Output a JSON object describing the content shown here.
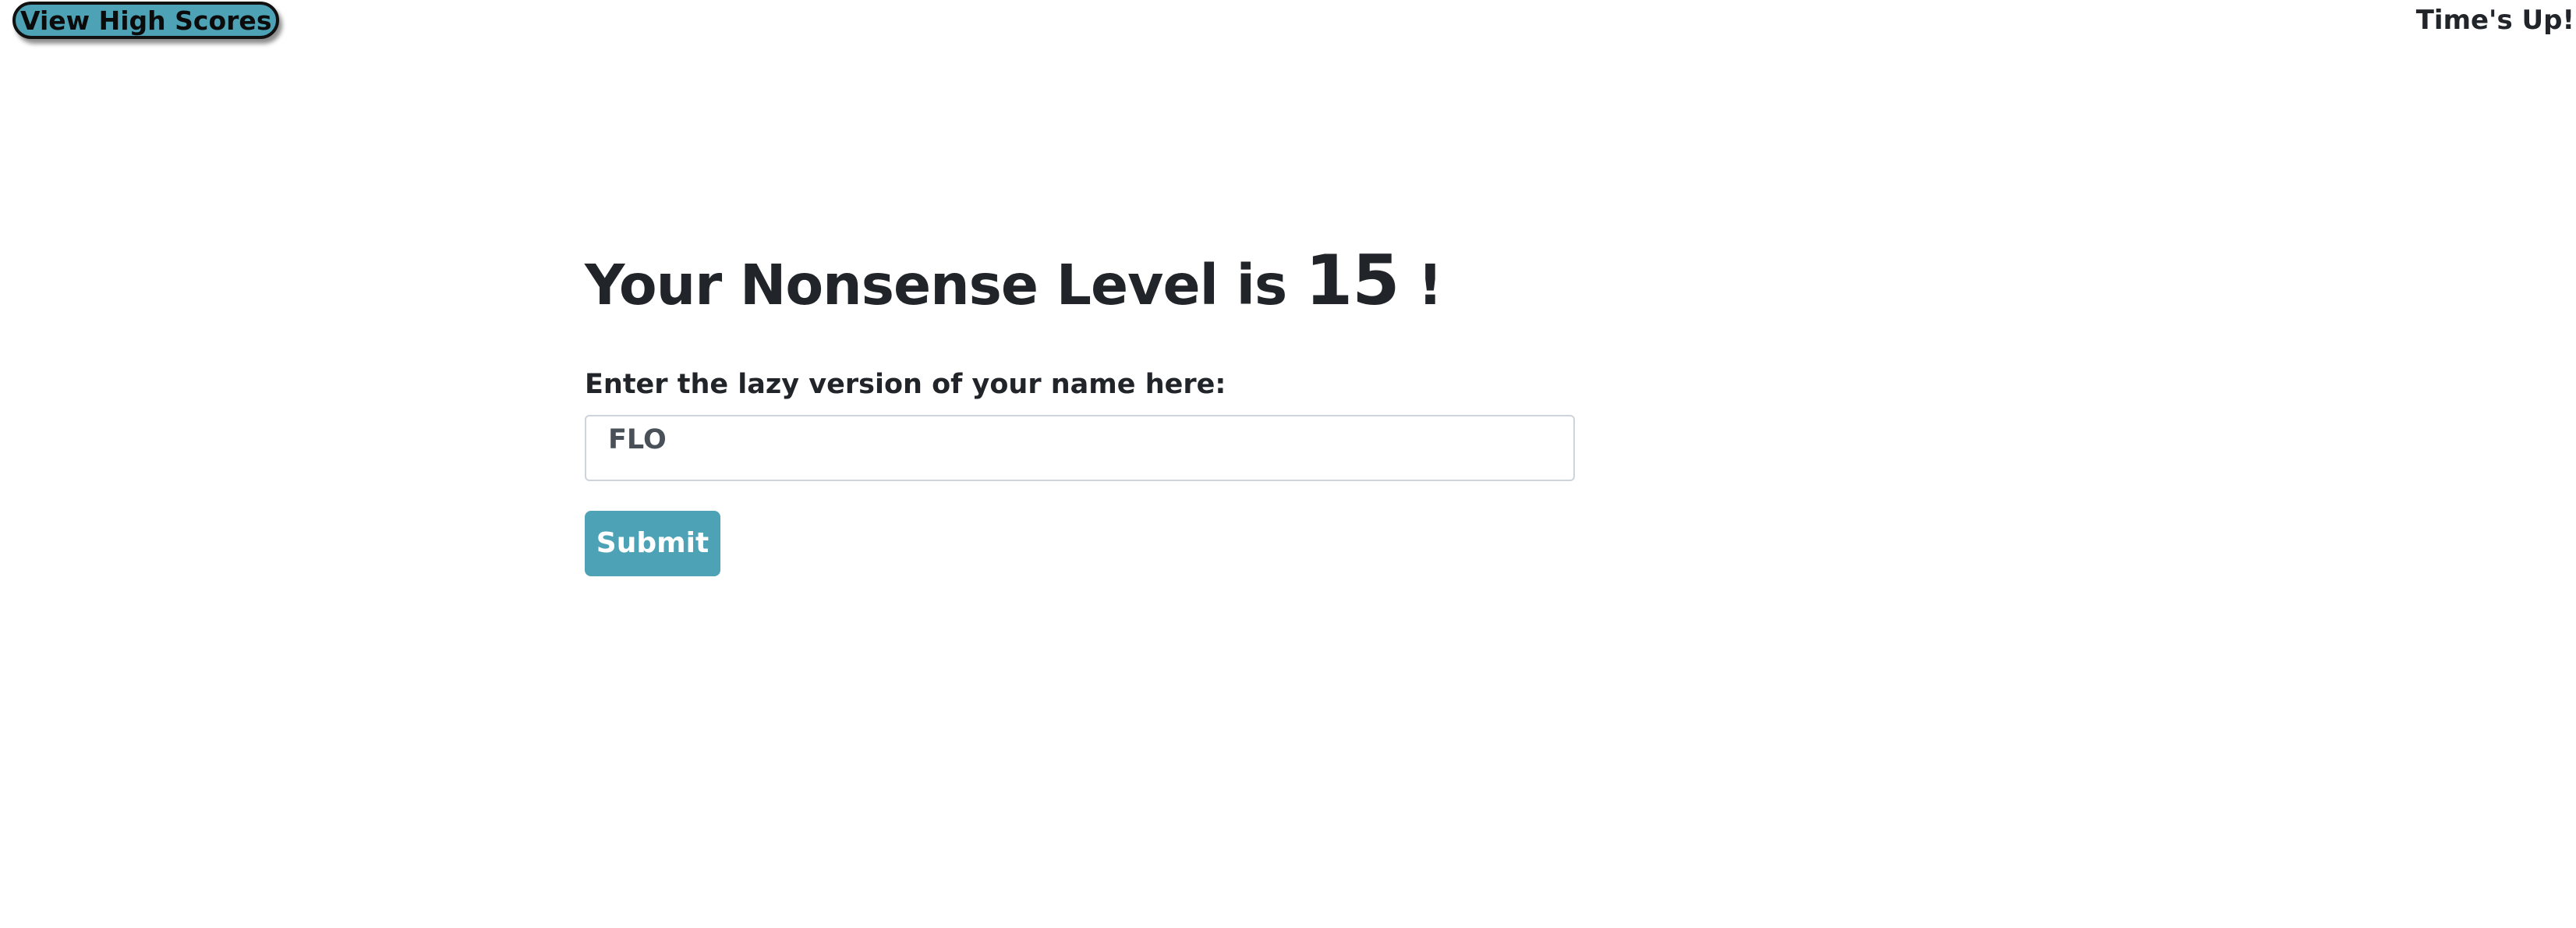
{
  "header": {
    "high_scores_label": "View High Scores",
    "timer_text": "Time's Up!"
  },
  "result": {
    "prefix": "Your Nonsense Level is",
    "score": "15",
    "suffix": "!"
  },
  "form": {
    "name_label": "Enter the lazy version of your name here:",
    "name_value": "FLO",
    "submit_label": "Submit"
  },
  "colors": {
    "accent": "#4ea2b5",
    "text": "#212529",
    "input_border": "#ced4da",
    "input_text": "#495057"
  }
}
